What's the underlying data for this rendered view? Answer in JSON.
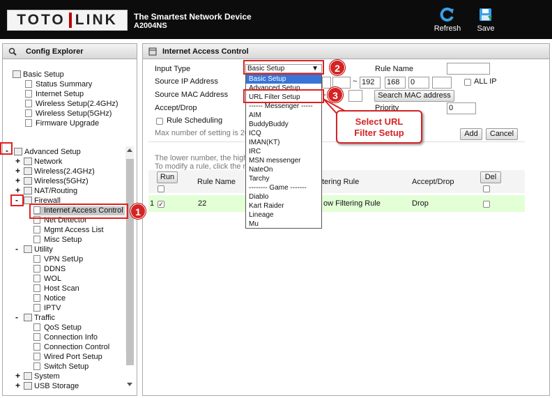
{
  "header": {
    "brand_left": "TOTO",
    "brand_right": "LINK",
    "tagline": "The Smartest Network Device",
    "model": "A2004NS",
    "refresh_label": "Refresh",
    "save_label": "Save"
  },
  "sidebar": {
    "title": "Config Explorer",
    "basic": {
      "label": "Basic Setup",
      "items": [
        "Status Summary",
        "Internet Setup",
        "Wireless Setup(2.4GHz)",
        "Wireless Setup(5GHz)",
        "Firmware Upgrade"
      ]
    },
    "advanced": {
      "label": "Advanced Setup",
      "toggle": "-",
      "groups": [
        "Network",
        "Wireless(2.4GHz)",
        "Wireless(5GHz)",
        "NAT/Routing"
      ]
    },
    "firewall": {
      "label": "Firewall",
      "items": [
        "Internet Access Control",
        "Net Detector",
        "Mgmt Access List",
        "Misc Setup"
      ]
    },
    "utility": {
      "label": "Utility",
      "items": [
        "VPN SetUp",
        "DDNS",
        "WOL",
        "Host Scan",
        "Notice",
        "IPTV"
      ]
    },
    "traffic": {
      "label": "Traffic",
      "items": [
        "QoS Setup",
        "Connection Info",
        "Connection Control",
        "Wired Port Setup",
        "Switch Setup"
      ]
    },
    "system": "System",
    "usb": "USB Storage",
    "plus": "+",
    "minus": "-"
  },
  "main": {
    "title": "Internet Access Control",
    "form": {
      "input_type_label": "Input Type",
      "input_type_value": "Basic Setup",
      "rule_name_label": "Rule Name",
      "source_ip_label": "Source IP Address",
      "ip_sep": "~",
      "ip_parts": [
        "192",
        "168",
        "0",
        ""
      ],
      "all_ip_label": "ALL IP",
      "source_mac_label": "Source MAC Address",
      "mac_dash": "-",
      "search_mac_label": "Search MAC address",
      "accept_drop_label": "Accept/Drop",
      "priority_label": "Priority",
      "priority_value": "0",
      "rule_sched_label": "Rule Scheduling",
      "max_text": "Max number of setting is 20",
      "add_label": "Add",
      "cancel_label": "Cancel"
    },
    "note1": "The lower number, the high",
    "note2": "To modify a rule, click the n",
    "table": {
      "run_label": "Run",
      "rule_name_header": "Rule Name",
      "filter_header": "tering Rule",
      "accept_header": "Accept/Drop",
      "del_label": "Del",
      "rows": [
        {
          "num": "1",
          "name": "22",
          "rule": "ow Filtering Rule",
          "action": "Drop"
        }
      ]
    }
  },
  "dropdown": [
    "Basic Setup",
    "Advanced Setup",
    "URL Filter Setup",
    "------ Messenger -----",
    "AIM",
    "BuddyBuddy",
    "ICQ",
    "IMAN(KT)",
    "IRC",
    "MSN messenger",
    "NateOn",
    "Tarchy",
    "-------- Game -------",
    "Diablo",
    "Kart Raider",
    "Lineage",
    "Mu"
  ],
  "annotations": {
    "badge1": "1",
    "badge2": "2",
    "badge3": "3",
    "callout_line1": "Select URL",
    "callout_line2": "Filter Setup"
  },
  "colors": {
    "accent": "#d52323",
    "highlight_row": "#e2ffd6",
    "selected_option": "#3875d7"
  }
}
